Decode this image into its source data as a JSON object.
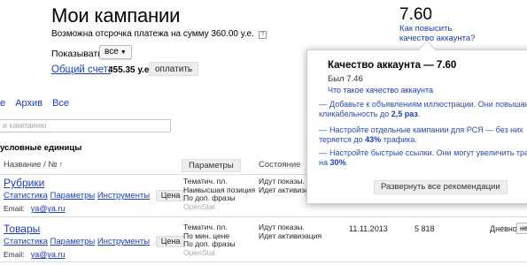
{
  "header": {
    "title": "Мои кампании",
    "deferral_text": "Возможна отсрочка платежа на сумму 360.00 у.е.",
    "help_icon": "?",
    "show_label": "Показывать:",
    "show_select": "все",
    "account_link": "Общий счет:",
    "account_amount": "455.35 у.е.",
    "pay_button": "оплатить"
  },
  "quality": {
    "score": "7.60",
    "arrow": "↑",
    "how_link_line1": "Как повысить",
    "how_link_line2": "качество аккаунта?"
  },
  "filters": {
    "tab_partial": "е",
    "tab_archive": "Архив",
    "tab_all": "Все",
    "search_placeholder": "и кампанию"
  },
  "units_label": "условные единицы",
  "table": {
    "col_name": "Название / №",
    "col_name_sort": "↑",
    "col_params": "Параметры",
    "col_state": "Состояние",
    "rows": [
      {
        "name": "Рубрики",
        "stats": "Статистика",
        "params": "Параметры",
        "tools": "Инструменты",
        "price": "Цена",
        "email_label": "Email:",
        "email": "ya@ya.ru",
        "meta1": "Тематич. пл.",
        "meta2": "Наивысшая позиция",
        "meta3": "По доп. фразы",
        "meta4": "OpenStat",
        "state1": "Идут показы.",
        "state2": "Идет активизация",
        "date": "",
        "count": "",
        "daily": ""
      },
      {
        "name": "Товары",
        "stats": "Статистика",
        "params": "Параметры",
        "tools": "Инструменты",
        "price": "Цена",
        "email_label": "Email:",
        "email": "ya@ya.ru",
        "meta1": "Тематич. пл.",
        "meta2": "По мин. цене",
        "meta3": "По доп. фразы",
        "meta4": "OpenStat",
        "state1": "Идут показы.",
        "state2": "Идет активизация",
        "date": "11.11.2013",
        "count": "5 818",
        "daily": "Дневной:",
        "daily_select": "не"
      }
    ]
  },
  "popup": {
    "title": "Качество аккаунта — 7.60",
    "was": "Был 7.46",
    "what_link": "Что такое качество аккаунта",
    "rec1_line1": "Добавьте к объявлениям иллюстрации. Они повышают",
    "rec1_line2_pre": "кликабельность до ",
    "rec1_line2_bold": "2,5 раз",
    "rec1_line2_post": ".",
    "rec2_line1": "Настройте отдельные кампании для РСЯ — без них",
    "rec2_line2_pre": "теряется до ",
    "rec2_line2_bold": "43%",
    "rec2_line2_post": " трафика.",
    "rec3_line1": "Настройте быстрые ссылки. Они могут увеличить трафик",
    "rec3_line2_pre": "на ",
    "rec3_line2_bold": "30%",
    "rec3_line2_post": ".",
    "expand_button": "Развернуть все рекомендации"
  },
  "colors": {
    "link": "#1a3dc1",
    "up_arrow": "#3b9a32"
  }
}
